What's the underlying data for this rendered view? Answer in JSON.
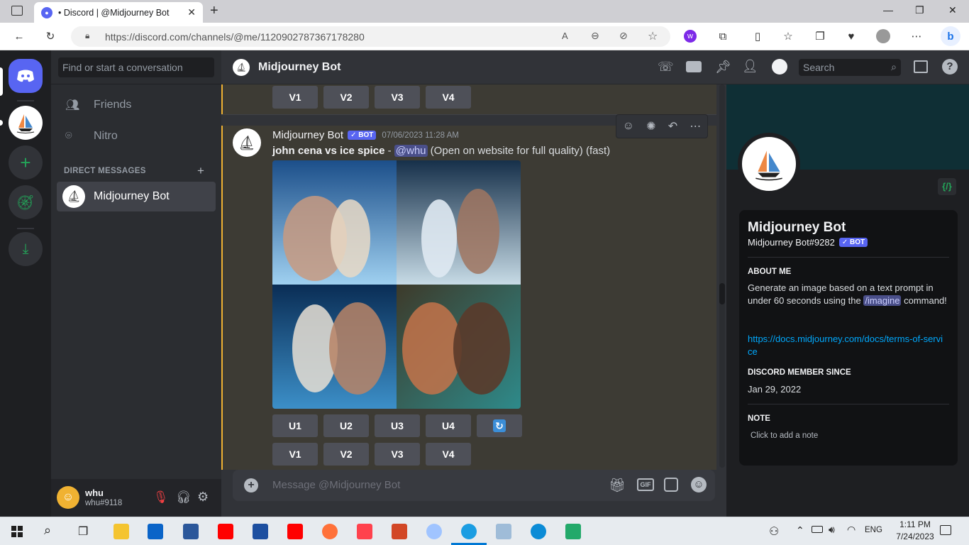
{
  "browser": {
    "tab_title": "• Discord | @Midjourney Bot",
    "url": "https://discord.com/channels/@me/1120902787367178280"
  },
  "discord": {
    "dm_search_placeholder": "Find or start a conversation",
    "nav": {
      "friends": "Friends",
      "nitro": "Nitro"
    },
    "direct_messages_label": "DIRECT MESSAGES",
    "dm_list": [
      {
        "name": "Midjourney Bot"
      }
    ],
    "channel_title": "Midjourney Bot",
    "header_search_placeholder": "Search",
    "message": {
      "author": "Midjourney Bot",
      "bot_badge": "✓ BOT",
      "timestamp": "07/06/2023 11:28 AM",
      "prompt": "john cena vs ice spice",
      "separator": " - ",
      "mention": "@whu",
      "suffix": " (Open on website for full quality) (fast)"
    },
    "buttons": {
      "prev_row": [
        "V1",
        "V2",
        "V3",
        "V4"
      ],
      "upscale": [
        "U1",
        "U2",
        "U3",
        "U4"
      ],
      "variations": [
        "V1",
        "V2",
        "V3",
        "V4"
      ]
    },
    "composer_placeholder": "Message @Midjourney Bot",
    "gif_label": "GIF",
    "user": {
      "name": "whu",
      "tag": "whu#9118"
    },
    "profile": {
      "name": "Midjourney Bot",
      "tag": "Midjourney Bot#9282",
      "bot_badge": "✓ BOT",
      "about_label": "ABOUT ME",
      "about_text_1": "Generate an image based on a text prompt in under 60 seconds using the ",
      "about_cmd": "/imagine",
      "about_text_2": " command!",
      "link": "https://docs.midjourney.com/docs/terms-of-service",
      "member_since_label": "DISCORD MEMBER SINCE",
      "member_since": "Jan 29, 2022",
      "note_label": "NOTE",
      "note_placeholder": "Click to add a note"
    }
  },
  "taskbar": {
    "time": "1:11 PM",
    "date": "7/24/2023",
    "lang": "ENG"
  },
  "colors": {
    "blurple": "#5865f2",
    "link": "#00a8fc",
    "bg_chat": "#313338",
    "bg_sidebar": "#2b2d31",
    "bg_dark": "#1e1f22"
  }
}
